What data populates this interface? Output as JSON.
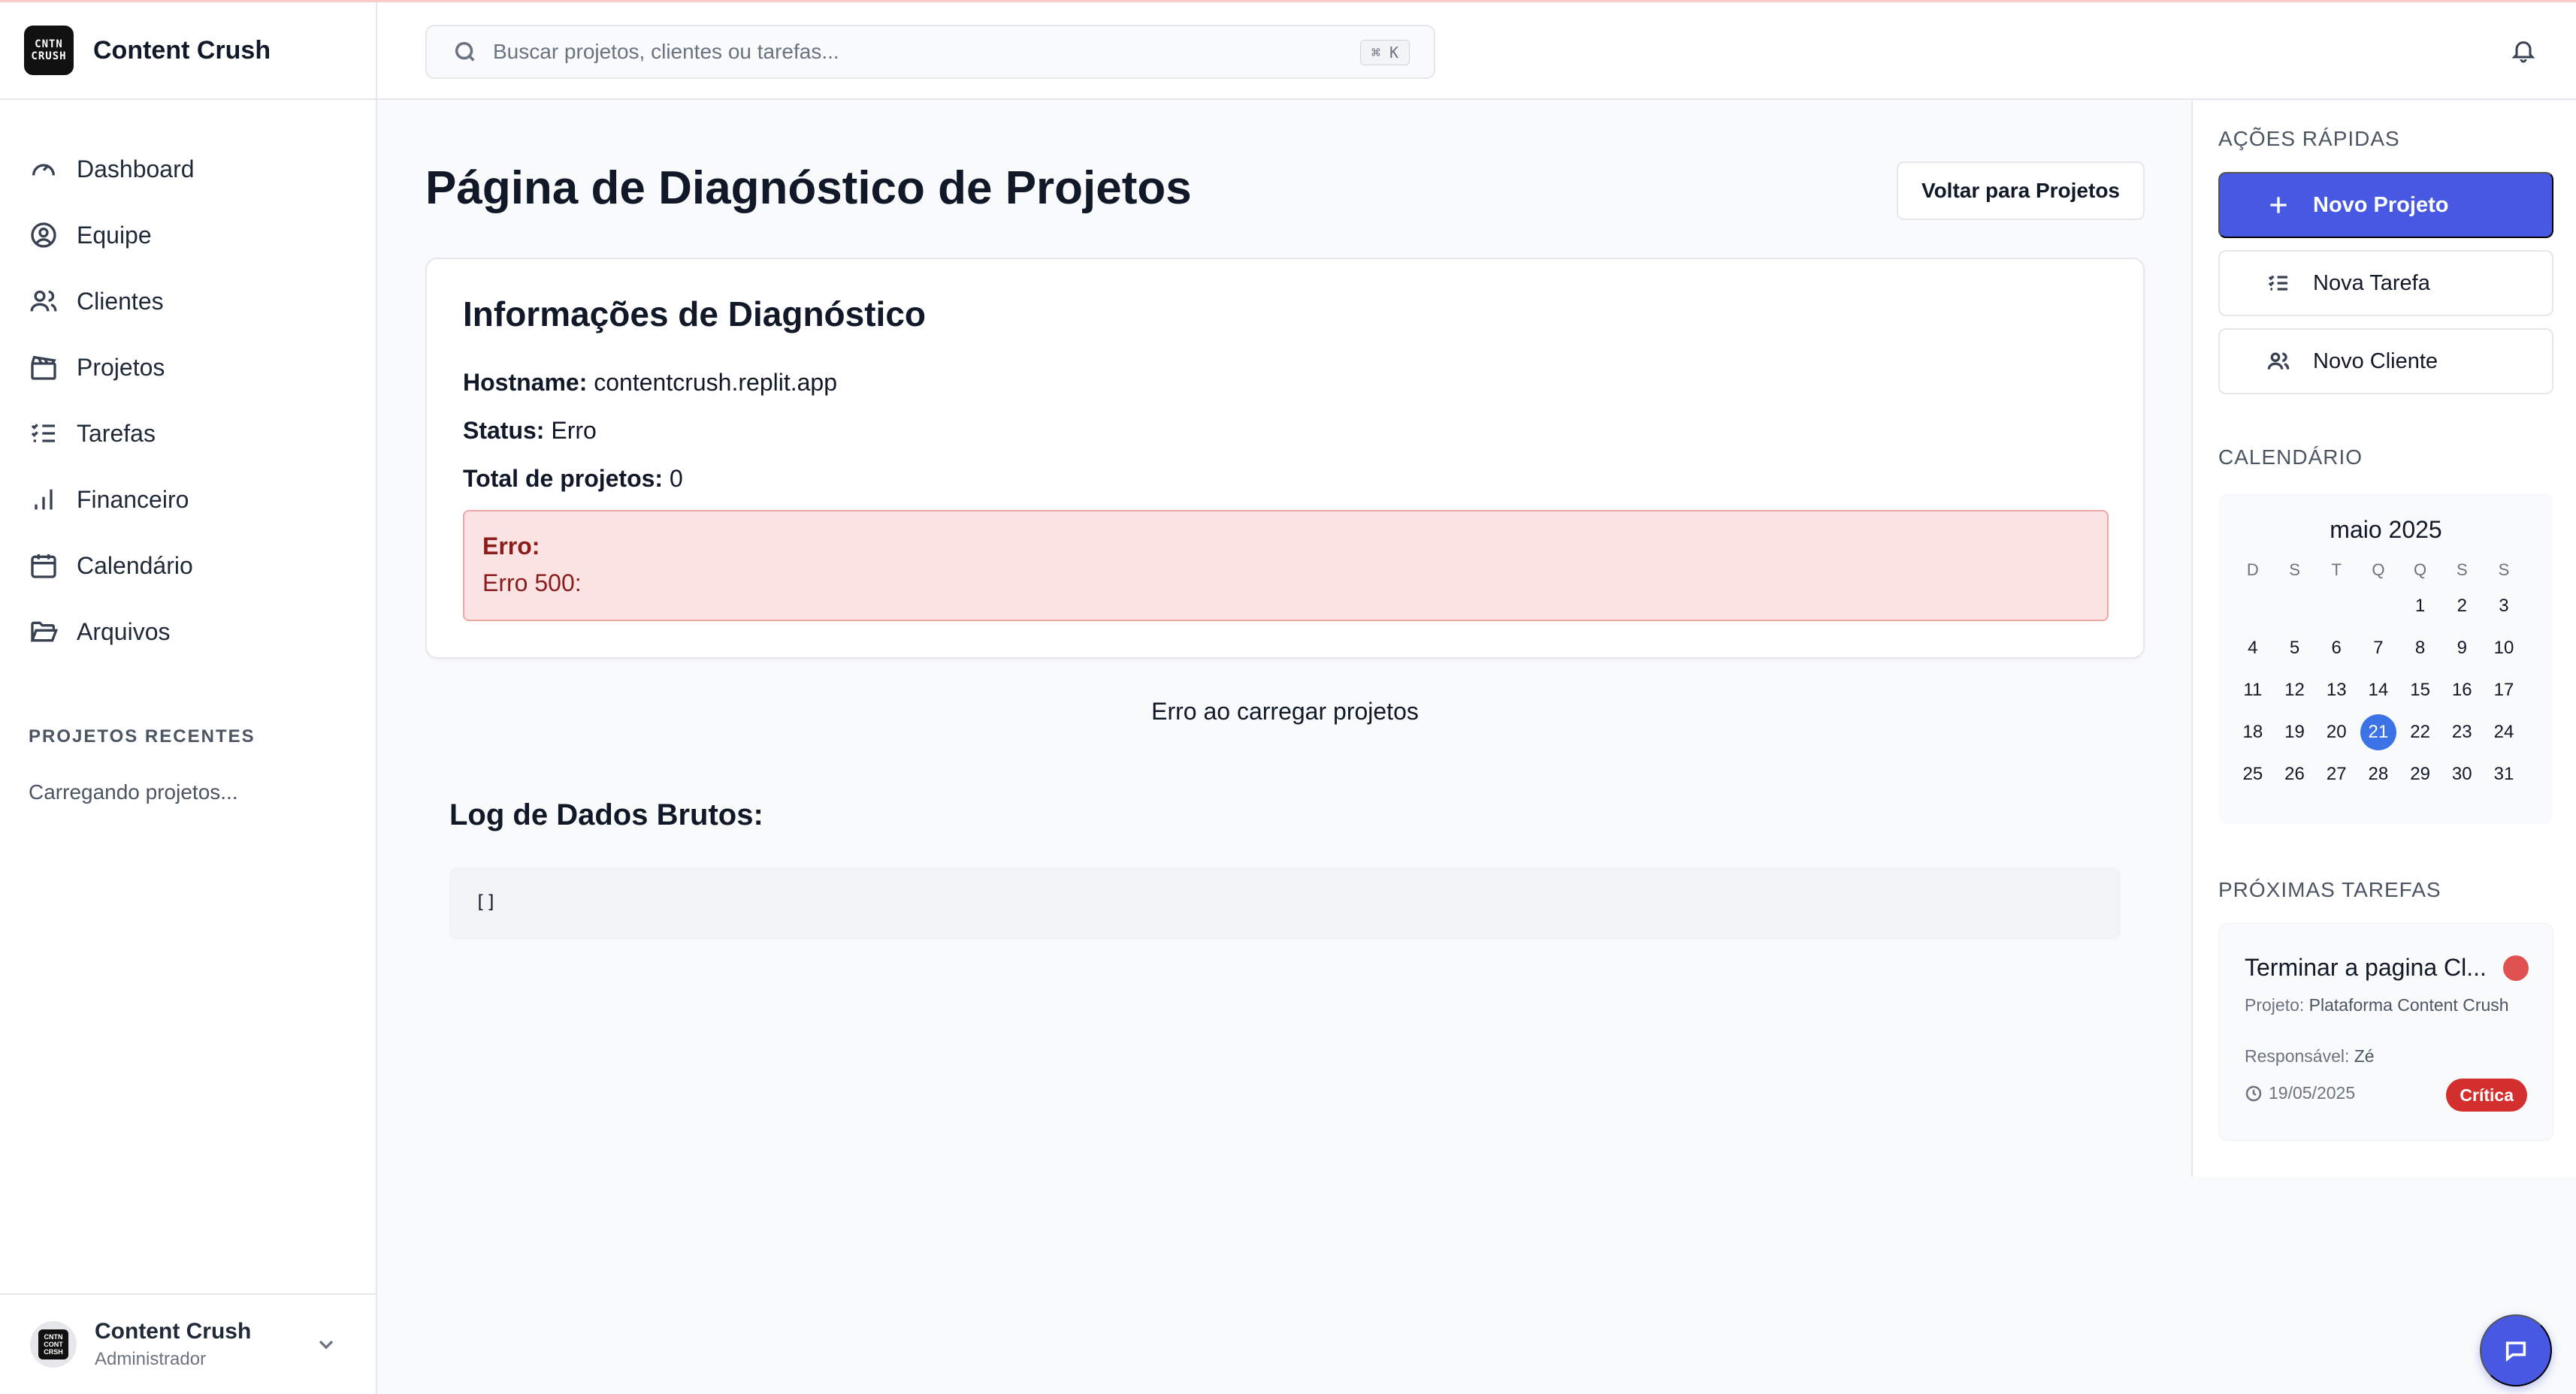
{
  "app": {
    "name": "Content Crush",
    "logo_lines": [
      "CNTN",
      "CRUSH"
    ],
    "avatar_lines": [
      "CNTN",
      "CONT",
      "CRSH"
    ]
  },
  "sidebar": {
    "items": [
      {
        "label": "Dashboard",
        "icon": "gauge-icon"
      },
      {
        "label": "Equipe",
        "icon": "user-circle-icon"
      },
      {
        "label": "Clientes",
        "icon": "users-icon"
      },
      {
        "label": "Projetos",
        "icon": "clapperboard-icon"
      },
      {
        "label": "Tarefas",
        "icon": "list-checks-icon"
      },
      {
        "label": "Financeiro",
        "icon": "bar-chart-icon"
      },
      {
        "label": "Calendário",
        "icon": "calendar-icon"
      },
      {
        "label": "Arquivos",
        "icon": "folder-icon"
      }
    ],
    "recent_label": "PROJETOS RECENTES",
    "recent_loading": "Carregando projetos...",
    "user": {
      "name": "Content Crush",
      "role": "Administrador"
    }
  },
  "header": {
    "search_placeholder": "Buscar projetos, clientes ou tarefas...",
    "shortcut": "⌘ K"
  },
  "main": {
    "title": "Página de Diagnóstico de Projetos",
    "back_button": "Voltar para Projetos",
    "diagnostics": {
      "title": "Informações de Diagnóstico",
      "hostname_label": "Hostname:",
      "hostname_value": "contentcrush.replit.app",
      "status_label": "Status:",
      "status_value": "Erro",
      "total_label": "Total de projetos:",
      "total_value": "0",
      "error_title": "Erro:",
      "error_message": "Erro 500:"
    },
    "load_error": "Erro ao carregar projetos",
    "raw_log": {
      "title": "Log de Dados Brutos:",
      "content": "[]"
    }
  },
  "right_panel": {
    "quick_actions_label": "AÇÕES RÁPIDAS",
    "actions": [
      {
        "label": "Novo Projeto",
        "icon": "plus-icon"
      },
      {
        "label": "Nova Tarefa",
        "icon": "list-checks-icon"
      },
      {
        "label": "Novo Cliente",
        "icon": "users-icon"
      }
    ],
    "calendar_label": "CALENDÁRIO",
    "calendar": {
      "month": "maio 2025",
      "weekdays": [
        "D",
        "S",
        "T",
        "Q",
        "Q",
        "S",
        "S"
      ],
      "weeks": [
        [
          "",
          "",
          "",
          "",
          "1",
          "2",
          "3"
        ],
        [
          "4",
          "5",
          "6",
          "7",
          "8",
          "9",
          "10"
        ],
        [
          "11",
          "12",
          "13",
          "14",
          "15",
          "16",
          "17"
        ],
        [
          "18",
          "19",
          "20",
          "21",
          "22",
          "23",
          "24"
        ],
        [
          "25",
          "26",
          "27",
          "28",
          "29",
          "30",
          "31"
        ]
      ],
      "today": "21"
    },
    "tasks_label": "PRÓXIMAS TAREFAS",
    "task": {
      "title": "Terminar a pagina Cl...",
      "project_label": "Projeto:",
      "project_value": "Plataforma Content Crush",
      "owner_label": "Responsável:",
      "owner_value": "Zé",
      "date": "19/05/2025",
      "priority": "Crítica"
    }
  },
  "colors": {
    "primary": "#4758e3",
    "today": "#3b73e6",
    "error_bg": "#fbe3e3",
    "error_text": "#8b1c1c",
    "critical": "#d32f2f"
  }
}
